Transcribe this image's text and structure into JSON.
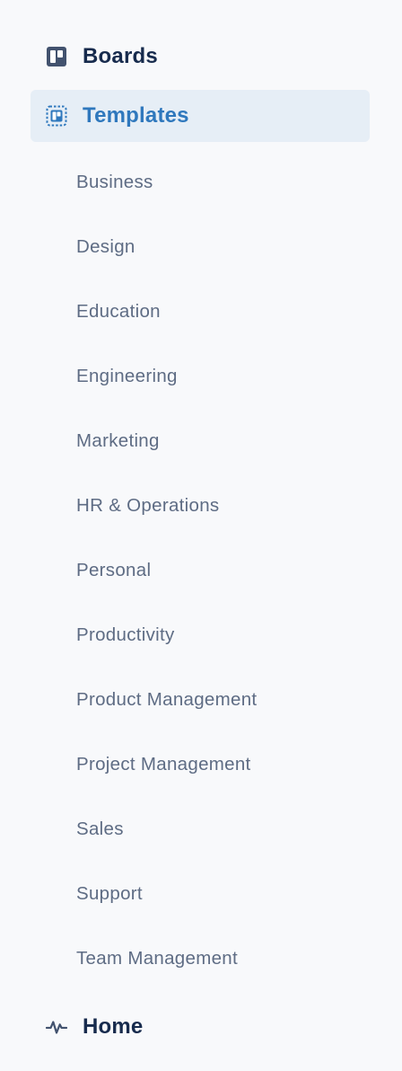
{
  "nav": {
    "boards": {
      "label": "Boards",
      "icon": "board-icon"
    },
    "templates": {
      "label": "Templates",
      "icon": "template-icon",
      "active": true
    },
    "home": {
      "label": "Home",
      "icon": "activity-icon"
    }
  },
  "template_categories": [
    {
      "label": "Business"
    },
    {
      "label": "Design"
    },
    {
      "label": "Education"
    },
    {
      "label": "Engineering"
    },
    {
      "label": "Marketing"
    },
    {
      "label": "HR & Operations"
    },
    {
      "label": "Personal"
    },
    {
      "label": "Productivity"
    },
    {
      "label": "Product Management"
    },
    {
      "label": "Project Management"
    },
    {
      "label": "Sales"
    },
    {
      "label": "Support"
    },
    {
      "label": "Team Management"
    }
  ],
  "colors": {
    "background": "#f8f9fb",
    "active_bg": "#e6eef6",
    "active_text": "#2f78bd",
    "primary_text": "#172b4d",
    "secondary_text": "#5e6c84"
  }
}
